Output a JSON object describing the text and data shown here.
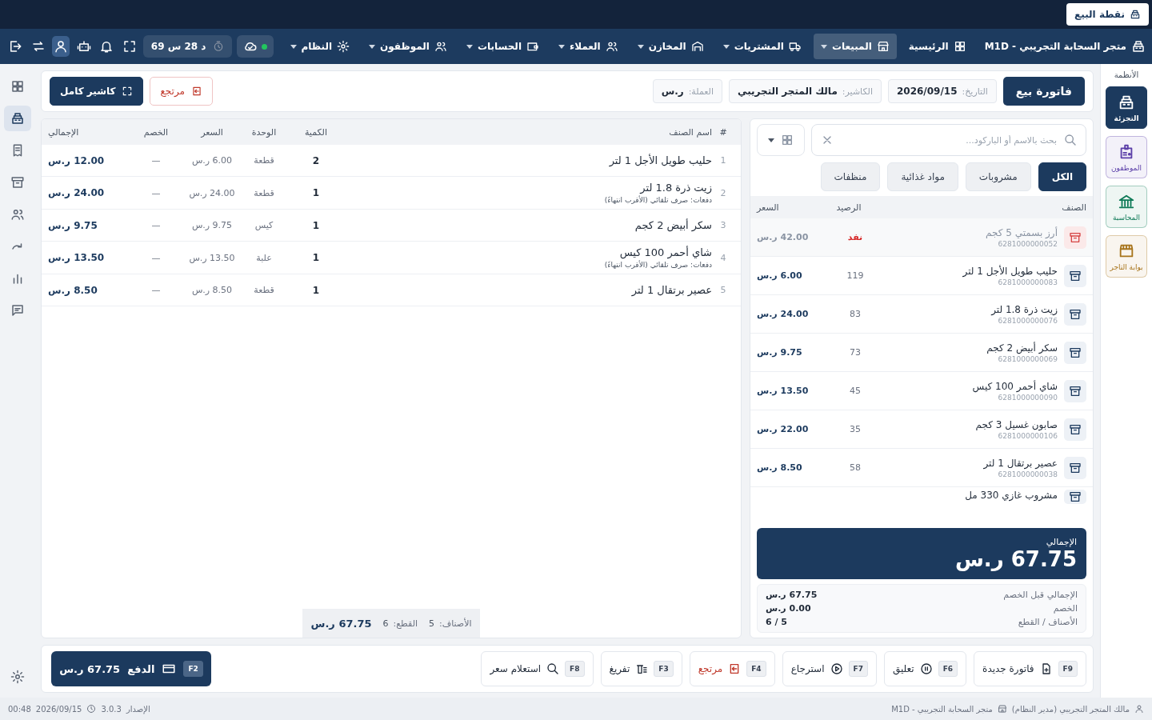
{
  "tab": {
    "label": "نقطة البيع"
  },
  "nav": {
    "brand": "متجر السحابة التجريبي - M1D",
    "items": [
      {
        "label": "الرئيسية",
        "selected": false,
        "dropdown": false
      },
      {
        "label": "المبيعات",
        "selected": true,
        "dropdown": true
      },
      {
        "label": "المشتريات",
        "selected": false,
        "dropdown": true
      },
      {
        "label": "المخازن",
        "selected": false,
        "dropdown": true
      },
      {
        "label": "العملاء",
        "selected": false,
        "dropdown": true
      },
      {
        "label": "الحسابات",
        "selected": false,
        "dropdown": true
      },
      {
        "label": "الموظفون",
        "selected": false,
        "dropdown": true
      },
      {
        "label": "النظام",
        "selected": false,
        "dropdown": true
      }
    ],
    "cloud": {
      "online": true
    },
    "timer": "69 س 28 د",
    "tools": [
      {
        "selected": false
      },
      {
        "selected": false
      },
      {
        "selected": false
      },
      {
        "selected": true
      },
      {
        "selected": false
      },
      {
        "selected": false
      }
    ]
  },
  "rail": {
    "items": [
      {
        "selected": false
      },
      {
        "selected": true
      },
      {
        "selected": false
      },
      {
        "selected": false
      },
      {
        "selected": false
      },
      {
        "selected": false
      },
      {
        "selected": false
      },
      {
        "selected": false
      }
    ]
  },
  "systems": {
    "title": "الأنظمة",
    "items": [
      {
        "label": "التجزئة",
        "selected": true,
        "color": "#1c3a5e"
      },
      {
        "label": "الموظفون",
        "selected": false,
        "color": "#5b3fa8"
      },
      {
        "label": "المحاسبة",
        "selected": false,
        "color": "#0e7a57"
      },
      {
        "label": "بوابة التاجر",
        "selected": false,
        "color": "#a7741b"
      }
    ]
  },
  "invoice": {
    "title": "فاتورة بيع",
    "fields": [
      {
        "label": "التاريخ:",
        "value": "2026/09/15"
      },
      {
        "label": "الكاشير:",
        "value": "مالك المتجر التجريبي"
      },
      {
        "label": "العملة:",
        "value": "ر.س"
      }
    ],
    "actions": [
      {
        "label": "مرتجع",
        "kind": "danger"
      },
      {
        "label": "كاشير كامل",
        "kind": "primary"
      }
    ]
  },
  "products": {
    "search": {
      "placeholder": "بحث بالاسم أو الباركود..."
    },
    "view_menu": {
      "expanded": false
    },
    "categories": [
      {
        "label": "الكل",
        "selected": true
      },
      {
        "label": "مشروبات",
        "selected": false
      },
      {
        "label": "مواد غذائية",
        "selected": false
      },
      {
        "label": "منظفات",
        "selected": false
      }
    ],
    "columns": [
      "الصنف",
      "الرصيد",
      "السعر"
    ],
    "rows": [
      {
        "name": "أرز بسمتي 5 كجم",
        "barcode": "6281000000052",
        "stock": "نفد",
        "price": "42.00 ر.س",
        "out_of_stock": true
      },
      {
        "name": "حليب طويل الأجل 1 لتر",
        "barcode": "6281000000083",
        "stock": "119",
        "price": "6.00 ر.س",
        "out_of_stock": false
      },
      {
        "name": "زيت ذرة 1.8 لتر",
        "barcode": "6281000000076",
        "stock": "83",
        "price": "24.00 ر.س",
        "out_of_stock": false
      },
      {
        "name": "سكر أبيض 2 كجم",
        "barcode": "6281000000069",
        "stock": "73",
        "price": "9.75 ر.س",
        "out_of_stock": false
      },
      {
        "name": "شاي أحمر 100 كيس",
        "barcode": "6281000000090",
        "stock": "45",
        "price": "13.50 ر.س",
        "out_of_stock": false
      },
      {
        "name": "صابون غسيل 3 كجم",
        "barcode": "6281000000106",
        "stock": "35",
        "price": "22.00 ر.س",
        "out_of_stock": false
      },
      {
        "name": "عصير برتقال 1 لتر",
        "barcode": "6281000000038",
        "stock": "58",
        "price": "8.50 ر.س",
        "out_of_stock": false
      },
      {
        "name": "مشروب غازي 330 مل",
        "out_of_stock": false
      }
    ],
    "total": {
      "label": "الإجمالي",
      "amount": "67.75 ر.س"
    },
    "summary": [
      {
        "label": "الإجمالي قبل الخصم",
        "value": "67.75 ر.س"
      },
      {
        "label": "الخصم",
        "value": "0.00 ر.س"
      },
      {
        "label": "الأصناف / القطع",
        "value": "5 / 6"
      }
    ]
  },
  "cart": {
    "columns": [
      "#",
      "اسم الصنف",
      "الكمية",
      "الوحدة",
      "السعر",
      "الخصم",
      "الإجمالي"
    ],
    "rows": [
      {
        "index": "1",
        "name": "حليب طويل الأجل 1 لتر",
        "qty": "2",
        "unit": "قطعة",
        "price": "6.00 ر.س",
        "discount": "—",
        "total": "12.00 ر.س"
      },
      {
        "index": "2",
        "name": "زيت ذرة 1.8 لتر",
        "note": "دفعات: صرف تلقائي (الأقرب انتهاءً)",
        "qty": "1",
        "unit": "قطعة",
        "price": "24.00 ر.س",
        "discount": "—",
        "total": "24.00 ر.س"
      },
      {
        "index": "3",
        "name": "سكر أبيض 2 كجم",
        "qty": "1",
        "unit": "كيس",
        "price": "9.75 ر.س",
        "discount": "—",
        "total": "9.75 ر.س"
      },
      {
        "index": "4",
        "name": "شاي أحمر 100 كيس",
        "note": "دفعات: صرف تلقائي (الأقرب انتهاءً)",
        "qty": "1",
        "unit": "علبة",
        "price": "13.50 ر.س",
        "discount": "—",
        "total": "13.50 ر.س"
      },
      {
        "index": "5",
        "name": "عصير برتقال 1 لتر",
        "qty": "1",
        "unit": "قطعة",
        "price": "8.50 ر.س",
        "discount": "—",
        "total": "8.50 ر.س"
      }
    ],
    "footer": {
      "items_label": "الأصناف:",
      "items": "5",
      "pieces_label": "القطع:",
      "pieces": "6",
      "total": "67.75 ر.س"
    }
  },
  "actions": [
    {
      "key": "F9",
      "label": "فاتورة جديدة",
      "kind": "normal"
    },
    {
      "key": "F6",
      "label": "تعليق",
      "kind": "normal"
    },
    {
      "key": "F7",
      "label": "استرجاع",
      "kind": "normal"
    },
    {
      "key": "F4",
      "label": "مرتجع",
      "kind": "danger"
    },
    {
      "key": "F3",
      "label": "تفريغ",
      "kind": "normal"
    },
    {
      "key": "F8",
      "label": "استعلام سعر",
      "kind": "normal"
    }
  ],
  "pay": {
    "key": "F2",
    "label": "الدفع",
    "amount": "67.75 ر.س"
  },
  "status": {
    "user": "مالك المتجر التجريبي (مدير النظام)",
    "store": "متجر السحابة التجريبي - M1D",
    "version_label": "الإصدار",
    "version": "3.0.3",
    "date": "2026/09/15",
    "time": "00:48"
  }
}
